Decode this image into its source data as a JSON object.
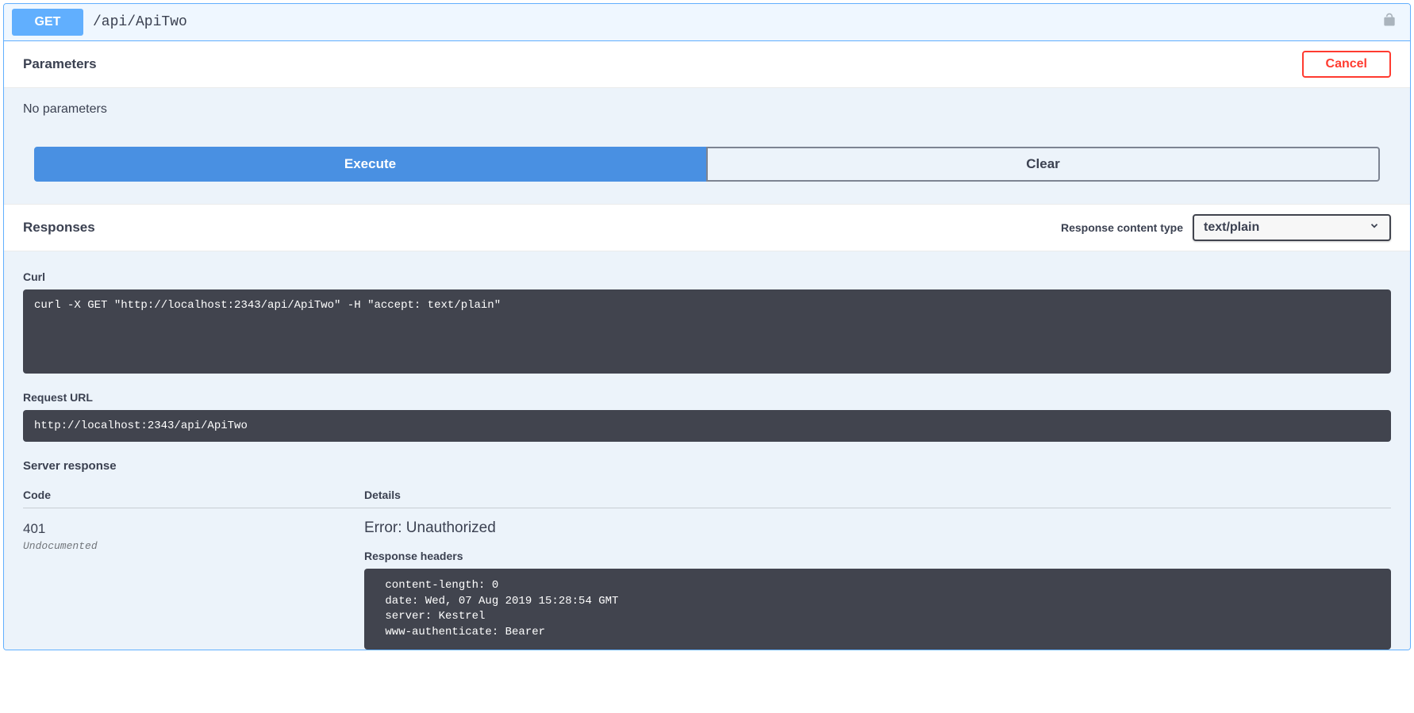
{
  "summary": {
    "method": "GET",
    "path": "/api/ApiTwo"
  },
  "parameters": {
    "title": "Parameters",
    "cancel_label": "Cancel",
    "no_parameters": "No parameters",
    "execute_label": "Execute",
    "clear_label": "Clear"
  },
  "responses": {
    "title": "Responses",
    "content_type_label": "Response content type",
    "content_type_value": "text/plain",
    "curl_label": "Curl",
    "curl_command": "curl -X GET \"http://localhost:2343/api/ApiTwo\" -H \"accept: text/plain\"",
    "request_url_label": "Request URL",
    "request_url": "http://localhost:2343/api/ApiTwo",
    "server_response_label": "Server response",
    "table": {
      "code_header": "Code",
      "details_header": "Details"
    },
    "result": {
      "code": "401",
      "undocumented": "Undocumented",
      "error_line": "Error: Unauthorized",
      "response_headers_label": "Response headers",
      "response_headers": " content-length: 0 \n date: Wed, 07 Aug 2019 15:28:54 GMT \n server: Kestrel \n www-authenticate: Bearer "
    }
  }
}
